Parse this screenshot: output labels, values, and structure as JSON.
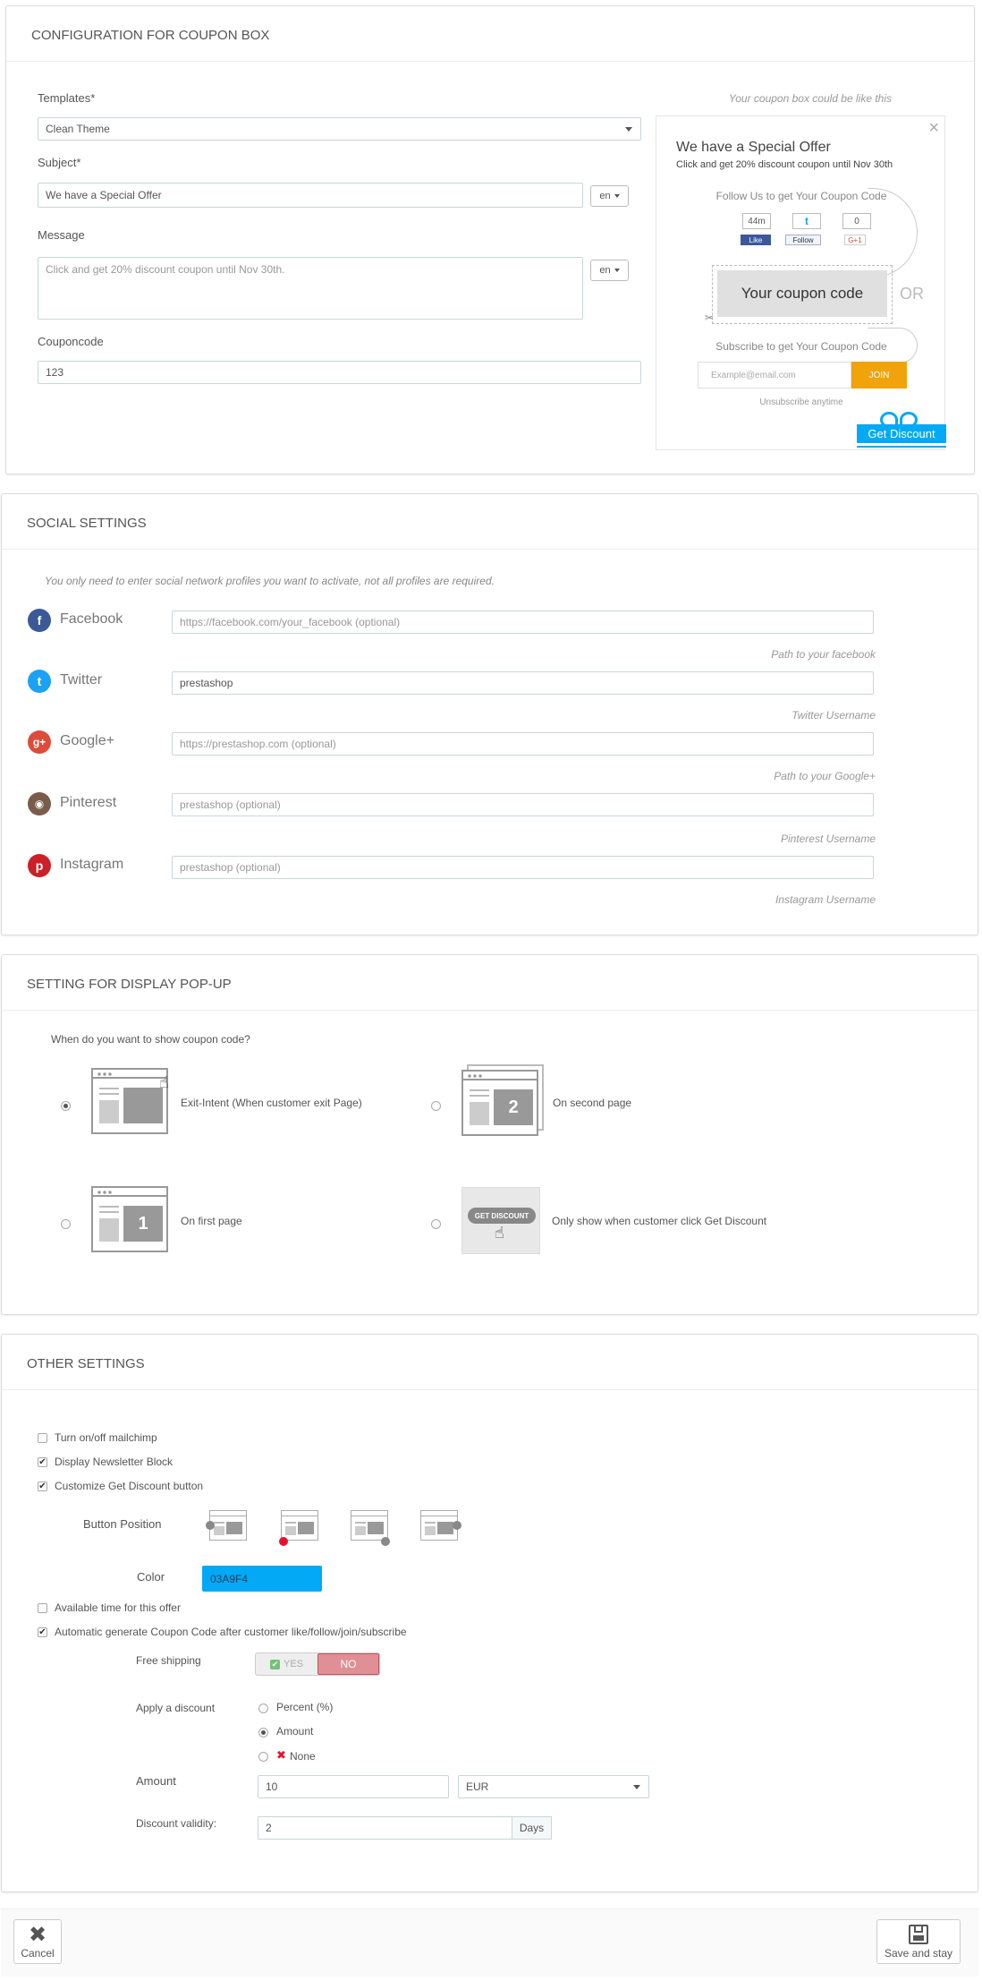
{
  "coupon_box": {
    "title": "CONFIGURATION FOR COUPON BOX",
    "templates_label": "Templates*",
    "templates_value": "Clean Theme",
    "subject_label": "Subject*",
    "subject_value": "We have a Special Offer",
    "lang": "en",
    "message_label": "Message",
    "message_value": "Click and get 20% discount coupon until Nov 30th.",
    "couponcode_label": "Couponcode",
    "couponcode_value": "123",
    "preview": {
      "caption": "Your coupon box could be like this",
      "headline": "We have a Special Offer",
      "subline": "Click and get 20% discount coupon until Nov 30th",
      "follow_text": "Follow Us to get Your Coupon Code",
      "fb_count": "44m",
      "gp_count": "0",
      "fb_btn": "Like",
      "tw_btn": "Follow",
      "gp_btn": "G+1",
      "coupon_text": "Your coupon code",
      "or_text": "OR",
      "subscribe_text": "Subscribe to get Your Coupon Code",
      "email_placeholder": "Example@email.com",
      "join": "JOIN",
      "unsubscribe": "Unsubscribe anytime",
      "get_discount": "Get Discount"
    }
  },
  "social": {
    "title": "SOCIAL SETTINGS",
    "note": "You only need to enter social network profiles you want to activate, not all profiles are required.",
    "items": [
      {
        "label": "Facebook",
        "placeholder": "https://facebook.com/your_facebook (optional)",
        "value": "",
        "help": "Path to your facebook",
        "color": "#3b5998",
        "glyph": "f"
      },
      {
        "label": "Twitter",
        "placeholder": "",
        "value": "prestashop",
        "help": "Twitter Username",
        "color": "#1da1f2",
        "glyph": "t"
      },
      {
        "label": "Google+",
        "placeholder": "https://prestashop.com (optional)",
        "value": "",
        "help": "Path to your Google+",
        "color": "#dd4b39",
        "glyph": "g+"
      },
      {
        "label": "Pinterest",
        "placeholder": "prestashop (optional)",
        "value": "",
        "help": "Pinterest Username",
        "color": "#7a5c4a",
        "glyph": "◉"
      },
      {
        "label": "Instagram",
        "placeholder": "prestashop (optional)",
        "value": "",
        "help": "Instagram Username",
        "color": "#cb2027",
        "glyph": "p"
      }
    ]
  },
  "display": {
    "title": "SETTING FOR DISPLAY POP-UP",
    "question": "When do you want to show coupon code?",
    "opt_exit": "Exit-Intent (When customer exit Page)",
    "opt_second": "On second page",
    "opt_first": "On first page",
    "opt_click": "Only show when customer click Get Discount",
    "num_two": "2",
    "num_one": "1",
    "get_discount_badge": "GET DISCOUNT"
  },
  "other": {
    "title": "OTHER SETTINGS",
    "mailchimp": "Turn on/off mailchimp",
    "newsletter": "Display Newsletter Block",
    "customize": "Customize Get Discount button",
    "button_position": "Button Position",
    "color_label": "Color",
    "color_value": "03A9F4",
    "color_hex": "#03A9F4",
    "available_time": "Available time for this offer",
    "auto_generate": "Automatic generate Coupon Code after customer like/follow/join/subscribe",
    "free_shipping": "Free shipping",
    "yes": "YES",
    "no": "NO",
    "apply_discount": "Apply a discount",
    "percent": "Percent (%)",
    "amount_opt": "Amount",
    "none": "None",
    "amount_label": "Amount",
    "amount_value": "10",
    "currency": "EUR",
    "validity_label": "Discount validity:",
    "validity_value": "2",
    "days": "Days"
  },
  "footer": {
    "cancel": "Cancel",
    "save": "Save and stay"
  }
}
